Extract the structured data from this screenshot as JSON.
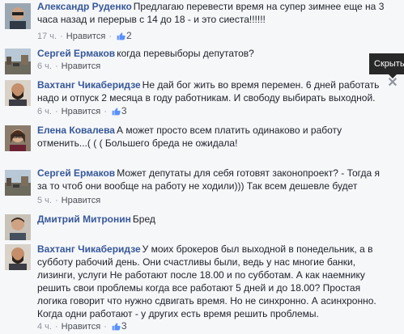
{
  "like_label": "Нравится",
  "separator": "·",
  "tooltip_hide": "Скрыть",
  "comments": [
    {
      "author": "Александр Руденко",
      "text": "Предлагаю перевести время на супер зимнее еще на 3 часа назад и перерыв с 14 до 18 - и это сиеста!!!!!!",
      "time": "17 ч.",
      "likes": "2",
      "avatar": "sunglasses-man"
    },
    {
      "author": "Сергей Ермаков",
      "text": "когда перевыборы депутатов?",
      "time": "6 ч.",
      "likes": "",
      "avatar": "street-landscape"
    },
    {
      "author": "Вахтанг Чикаберидзе",
      "text": "Не дай бог жить во время перемен. 6 дней работать надо и отпуск 2 месяца в году работникам. И свободу выбирать выходной.",
      "time": "6 ч.",
      "likes": "3",
      "avatar": "bearded-man"
    },
    {
      "author": "Елена Ковалева",
      "text": "А может просто всем платить одинаково и работу отменить...( ( ( Большего бреда не ожидала!",
      "time": "6 ч.",
      "likes": "",
      "avatar": "woman-glasses"
    },
    {
      "author": "Сергей Ермаков",
      "text": "Может депутаты для себя готовят законопроект? - Тогда я за то чтоб они вообще на работу не ходили))) Так всем дешевле будет",
      "time": "5 ч.",
      "likes": "",
      "avatar": "street-landscape"
    },
    {
      "author": "Дмитрий Митронин",
      "text": "Бред",
      "time": "",
      "likes": "",
      "avatar": "man-portrait"
    },
    {
      "author": "Вахтанг Чикаберидзе",
      "text": "У моих брокеров был выходной в понедельник, а в субботу рабочий день. Они счастливы были, ведь у нас многие банки, лизинги, услуги Не работают после 18.00 и по субботам. А как наемнику решить свои проблемы когда все работают 5 дней и до 18.00? Простая логика говорит что нужно сдвигать время. Но не синхронно. А асинхронно. Когда одни работают - у других есть время решить проблемы.",
      "time": "4 ч.",
      "likes": "3",
      "avatar": "bearded-man"
    }
  ]
}
